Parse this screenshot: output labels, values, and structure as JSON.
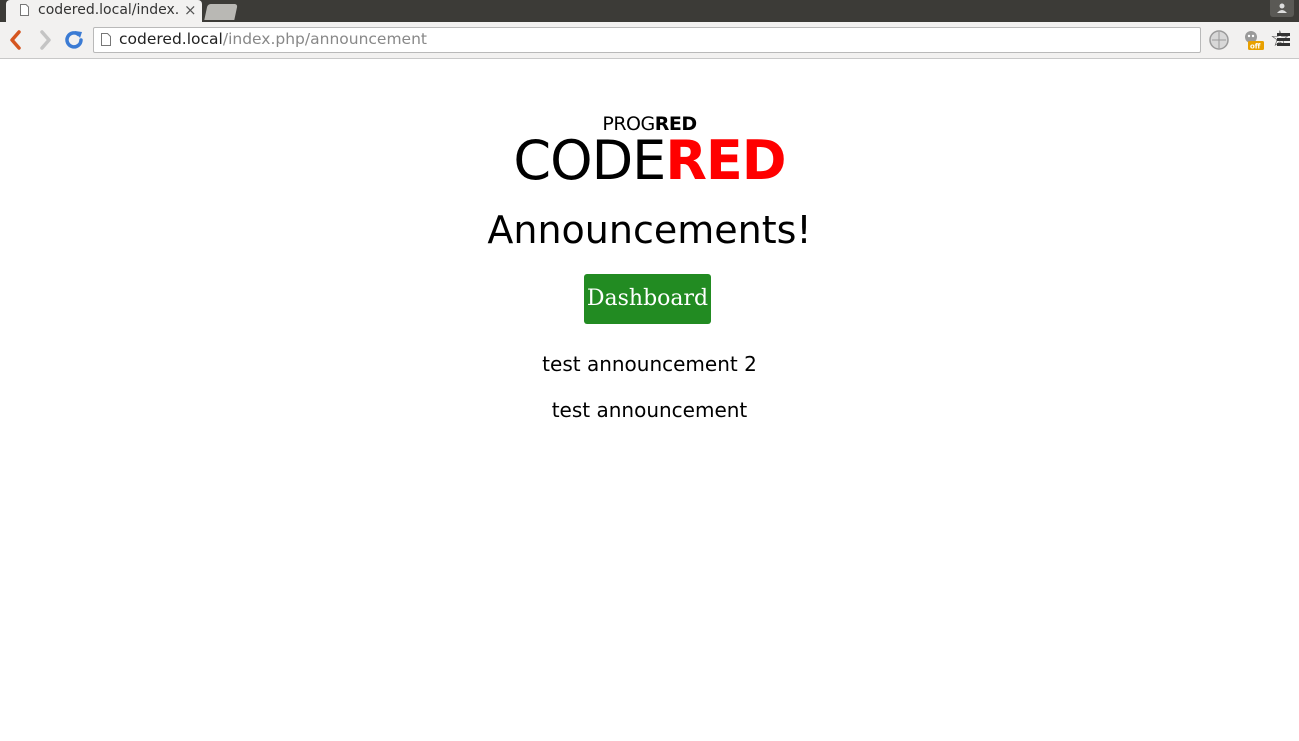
{
  "browser": {
    "tab_title": "codered.local/index.php/announcement",
    "tab_close": "×",
    "url_host": "codered.local",
    "url_path": "/index.php/announcement",
    "star": "☆"
  },
  "page": {
    "brand_small_a": "PROG",
    "brand_small_b": "RED",
    "brand_big_a": "CODE",
    "brand_big_b": "RED",
    "title": "Announcements!",
    "dashboard_button": "Dashboard",
    "announcements": [
      "test announcement 2",
      "test announcement"
    ]
  },
  "colors": {
    "brand_red": "#ff0000",
    "button_green": "#228b22"
  }
}
